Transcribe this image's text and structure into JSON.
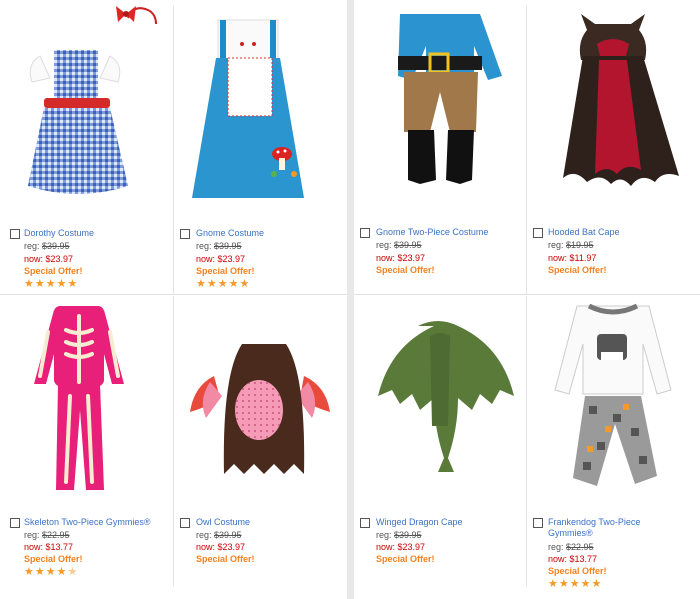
{
  "products": [
    {
      "name": "Dorothy Costume",
      "reg_label": "reg:",
      "reg_price": "$39.95",
      "now_label": "now:",
      "now_price": "$23.97",
      "offer": "Special Offer!",
      "rating": 5
    },
    {
      "name": "Gnome Costume",
      "reg_label": "reg:",
      "reg_price": "$39.95",
      "now_label": "now:",
      "now_price": "$23.97",
      "offer": "Special Offer!",
      "rating": 5
    },
    {
      "name": "Gnome Two-Piece Costume",
      "reg_label": "reg:",
      "reg_price": "$39.95",
      "now_label": "now:",
      "now_price": "$23.97",
      "offer": "Special Offer!",
      "rating": 0
    },
    {
      "name": "Hooded Bat Cape",
      "reg_label": "reg:",
      "reg_price": "$19.95",
      "now_label": "now:",
      "now_price": "$11.97",
      "offer": "Special Offer!",
      "rating": 0
    },
    {
      "name": "Skeleton Two-Piece Gymmies®",
      "reg_label": "reg:",
      "reg_price": "$22.95",
      "now_label": "now:",
      "now_price": "$13.77",
      "offer": "Special Offer!",
      "rating": 4.5
    },
    {
      "name": "Owl Costume",
      "reg_label": "reg:",
      "reg_price": "$39.95",
      "now_label": "now:",
      "now_price": "$23.97",
      "offer": "Special Offer!",
      "rating": 0
    },
    {
      "name": "Winged Dragon Cape",
      "reg_label": "reg:",
      "reg_price": "$39.95",
      "now_label": "now:",
      "now_price": "$23.97",
      "offer": "Special Offer!",
      "rating": 0
    },
    {
      "name": "Frankendog Two-Piece Gymmies®",
      "reg_label": "reg:",
      "reg_price": "$22.95",
      "now_label": "now:",
      "now_price": "$13.77",
      "offer": "Special Offer!",
      "rating": 5
    }
  ],
  "colors": {
    "link": "#3b72c4",
    "now_price": "#cc0000",
    "offer": "#f58220",
    "star": "#f39a2a"
  }
}
